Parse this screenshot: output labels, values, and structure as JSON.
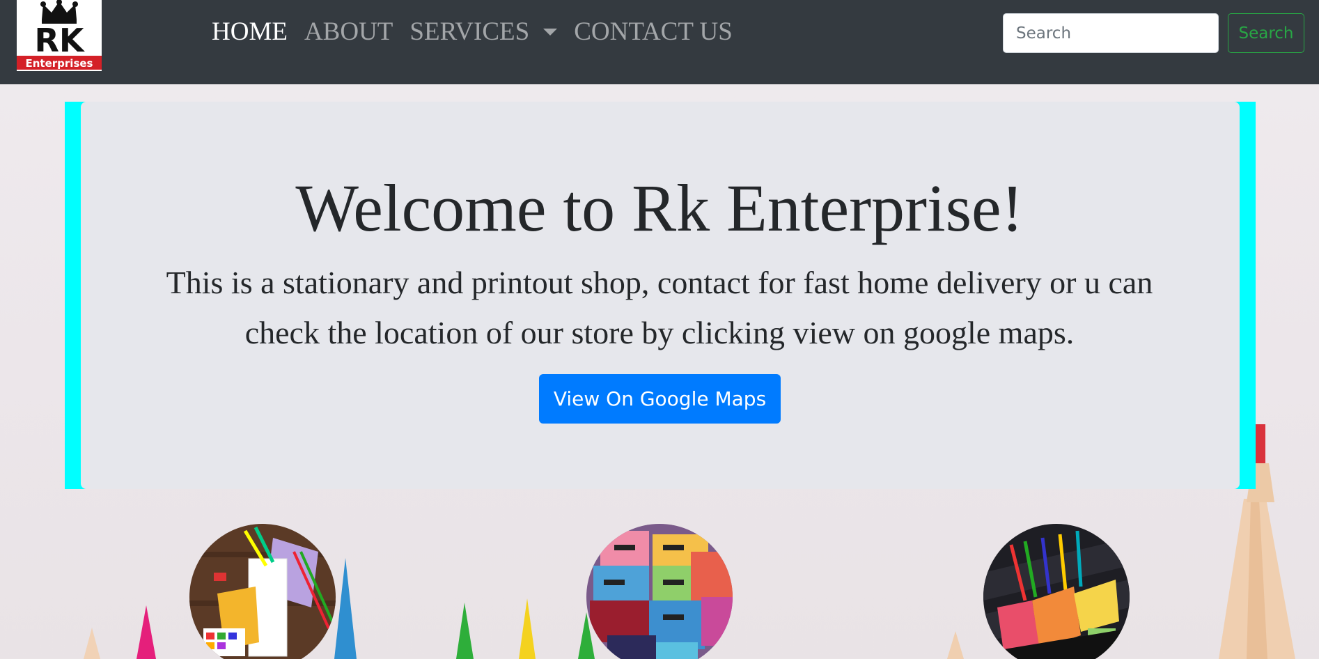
{
  "brand": {
    "logo_letters": "RK",
    "logo_caption": "Enterprises"
  },
  "nav": {
    "items": [
      {
        "label": "HOME",
        "active": true
      },
      {
        "label": "ABOUT",
        "active": false
      },
      {
        "label": "SERVICES",
        "active": false,
        "dropdown": true
      },
      {
        "label": "CONTACT US",
        "active": false
      }
    ]
  },
  "search": {
    "placeholder": "Search",
    "button_label": "Search"
  },
  "jumbotron": {
    "title": "Welcome to Rk Enterprise!",
    "lead": "This is a stationary and printout shop, contact for fast home delivery or u can check the location of our store by clicking view on google maps.",
    "button_label": "View On Google Maps"
  },
  "colors": {
    "navbar": "#343a40",
    "accent_border": "#00ffff",
    "primary": "#007bff",
    "success": "#28a745",
    "jumbotron_bg": "#e6e7ec"
  },
  "services": [
    {
      "image": "stationery-flatlay"
    },
    {
      "image": "classmate-notebooks"
    },
    {
      "image": "pen-organizer"
    }
  ]
}
